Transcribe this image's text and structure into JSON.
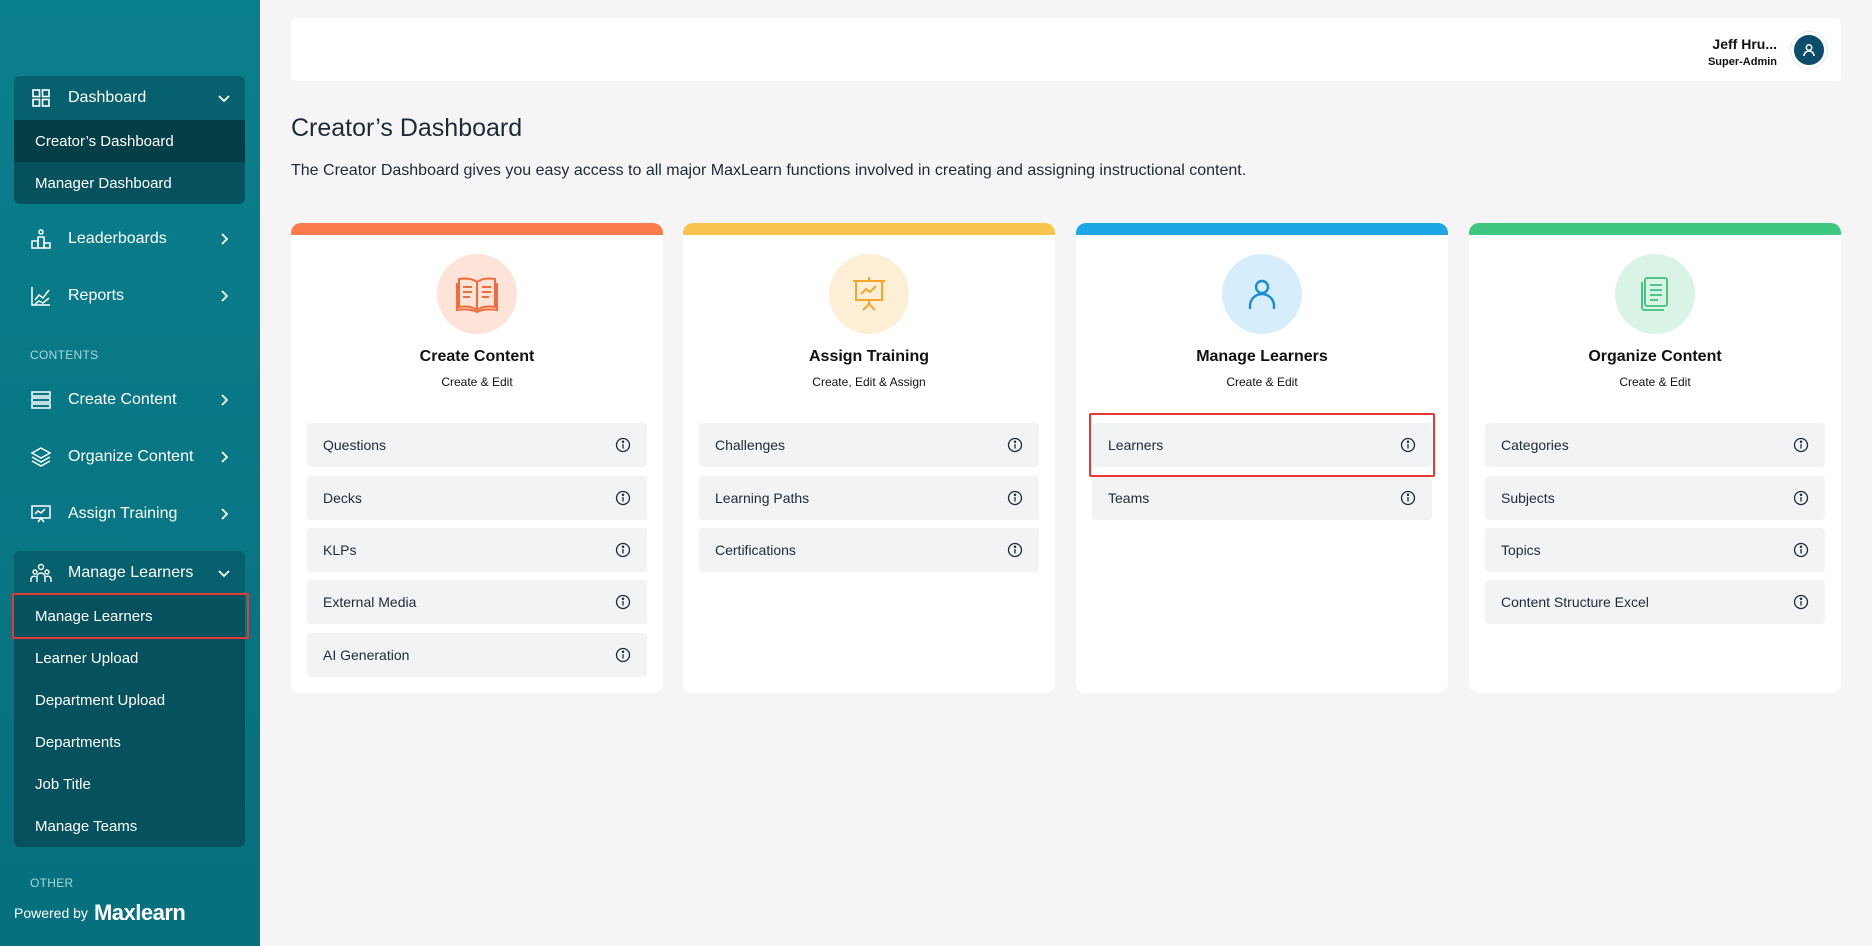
{
  "sidebar": {
    "dashboard": {
      "label": "Dashboard",
      "children": [
        "Creator’s Dashboard",
        "Manager Dashboard"
      ]
    },
    "leaderboards": "Leaderboards",
    "reports": "Reports",
    "section_contents": "CONTENTS",
    "create_content": "Create Content",
    "organize_content": "Organize Content",
    "assign_training": "Assign Training",
    "manage_learners": {
      "label": "Manage Learners",
      "children": [
        "Manage Learners",
        "Learner Upload",
        "Department Upload",
        "Departments",
        "Job Title",
        "Manage Teams"
      ]
    },
    "section_other": "OTHER",
    "powered_by": "Powered by",
    "brand": "Maxlearn"
  },
  "header": {
    "user_name": "Jeff Hru...",
    "user_role": "Super-Admin"
  },
  "main": {
    "title": "Creator’s Dashboard",
    "description": "The Creator Dashboard gives you easy access to all major MaxLearn functions involved in creating and assigning instructional content.",
    "cards": [
      {
        "title": "Create Content",
        "subtitle": "Create & Edit",
        "color": "#f97b4b",
        "circle": "#fde3d8",
        "icon": "book-icon",
        "items": [
          "Questions",
          "Decks",
          "KLPs",
          "External Media",
          "AI Generation"
        ]
      },
      {
        "title": "Assign Training",
        "subtitle": "Create, Edit & Assign",
        "color": "#f8c54e",
        "circle": "#fdefd6",
        "icon": "presentation-icon",
        "items": [
          "Challenges",
          "Learning Paths",
          "Certifications"
        ]
      },
      {
        "title": "Manage Learners",
        "subtitle": "Create & Edit",
        "color": "#1ea7e4",
        "circle": "#d6eefb",
        "icon": "user-icon",
        "items": [
          "Learners",
          "Teams"
        ]
      },
      {
        "title": "Organize Content",
        "subtitle": "Create & Edit",
        "color": "#3fc77f",
        "circle": "#d9f4e6",
        "icon": "document-icon",
        "items": [
          "Categories",
          "Subjects",
          "Topics",
          "Content Structure Excel"
        ]
      }
    ]
  }
}
